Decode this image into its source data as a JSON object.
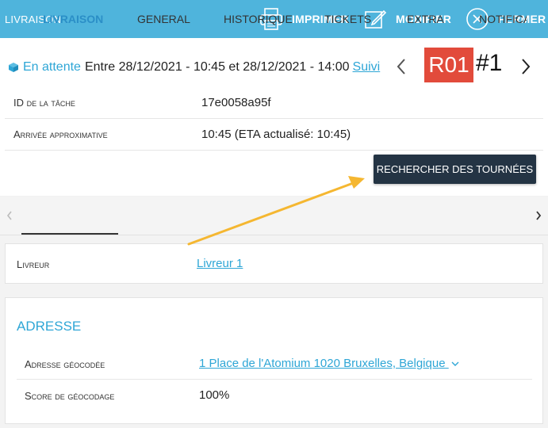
{
  "topbar": {
    "title": "LIVRAISON",
    "print_label": "IMPRIMER",
    "edit_label": "MODIFIER",
    "close_label": "FERMER",
    "background": "#4fb4dc"
  },
  "task": {
    "status": "En attente",
    "time_window": "Entre 28/12/2021 - 10:45 et 28/12/2021 - 14:00",
    "track_link": "Suivi",
    "route_badge": "R01",
    "route_number": "#1",
    "badge_color": "#e24b3b"
  },
  "details": [
    {
      "label": "ID de la tâche",
      "value": "17e0058a95f"
    },
    {
      "label": "Arrivée approximative",
      "value": "10:45 (ETA actualisé: 10:45)"
    }
  ],
  "search_routes_button": "RECHERCHER DES TOURNÉES",
  "tabs": [
    {
      "label": "LIVRAISON",
      "active": true
    },
    {
      "label": "GENERAL",
      "active": false
    },
    {
      "label": "HISTORIQUE",
      "active": false
    },
    {
      "label": "TICKETS",
      "active": false
    },
    {
      "label": "EXTRA",
      "active": false
    },
    {
      "label": "NOTIFICA",
      "active": false
    }
  ],
  "driver": {
    "label": "Livreur",
    "value": "Livreur 1"
  },
  "address": {
    "heading": "ADRESSE",
    "rows": [
      {
        "label": "Adresse géocodée",
        "value": "1 Place de l'Atomium 1020 Bruxelles, Belgique"
      },
      {
        "label": "Score de géocodage",
        "value": "100%"
      }
    ]
  },
  "colors": {
    "accent": "#2ea6d6",
    "dark_button": "#243444",
    "annotation_arrow": "#f5b731"
  }
}
